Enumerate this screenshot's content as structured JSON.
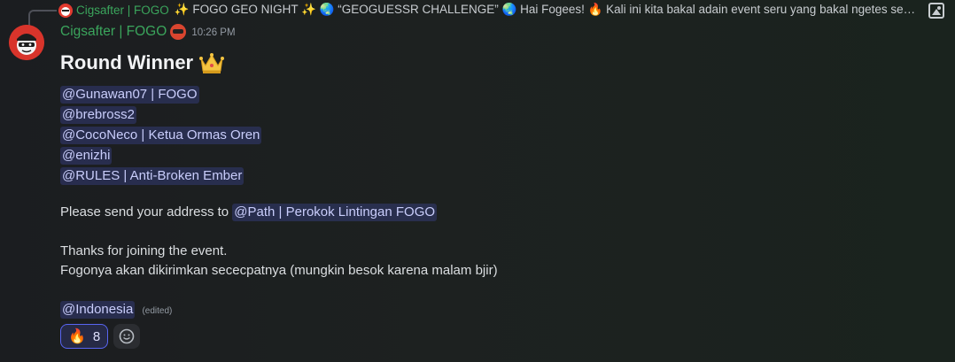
{
  "reply": {
    "author": "Cigsafter | FOGO",
    "preview": "✨ FOGO GEO NIGHT ✨ 🌏 “GEOGUESSR CHALLENGE” 🌏  Hai Fogees! 🔥 Kali ini kita bakal adain event seru yang bakal ngetes seberapa j..."
  },
  "message": {
    "author": "Cigsafter | FOGO",
    "timestamp": "10:26 PM",
    "title": "Round Winner",
    "winners": [
      "@Gunawan07 | FOGO",
      "@brebross2",
      "@CocoNeco | Ketua Ormas Oren",
      "@enizhi",
      "@RULES | Anti-Broken Ember"
    ],
    "address_prefix": "Please send your address to",
    "address_mention": "@Path | Perokok Lintingan FOGO",
    "thanks": "Thanks for joining the event.",
    "delivery": "Fogonya akan dikirimkan sececpatnya (mungkin besok karena malam bjir)",
    "role_mention": "@Indonesia",
    "edited_label": "(edited)"
  },
  "reactions": [
    {
      "emoji": "🔥",
      "count": "8"
    }
  ]
}
